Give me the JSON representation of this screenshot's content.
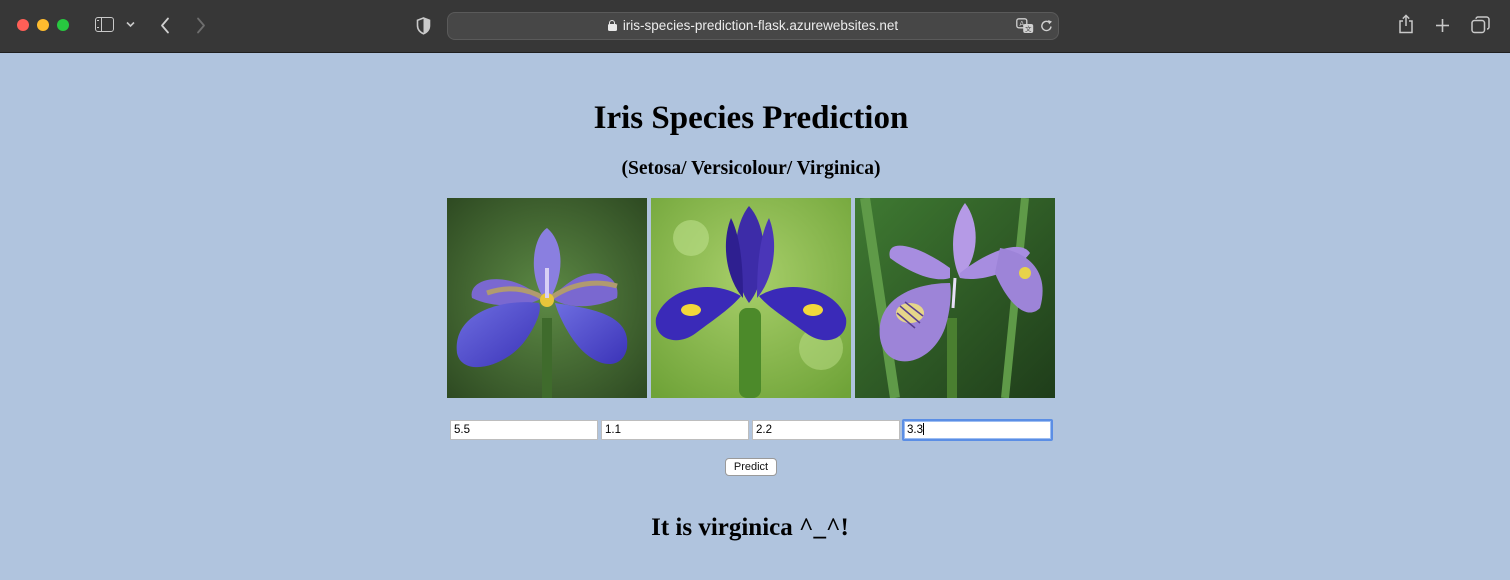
{
  "browser": {
    "url": "iris-species-prediction-flask.azurewebsites.net"
  },
  "page": {
    "title": "Iris Species Prediction",
    "subtitle": "(Setosa/ Versicolour/ Virginica)",
    "inputs": [
      {
        "value": "5.5"
      },
      {
        "value": "1.1"
      },
      {
        "value": "2.2"
      },
      {
        "value": "3.3"
      }
    ],
    "predict_label": "Predict",
    "result": "It is virginica ^_^!"
  },
  "colors": {
    "page_background": "#b0c4de",
    "toolbar": "#373737",
    "focus_ring": "#5b8ee5"
  },
  "icons": [
    "close-window-icon",
    "minimize-window-icon",
    "zoom-window-icon",
    "sidebar-icon",
    "chevron-down-icon",
    "back-arrow-icon",
    "forward-arrow-icon",
    "shield-icon",
    "lock-icon",
    "translate-icon",
    "reload-icon",
    "share-icon",
    "new-tab-icon",
    "tab-overview-icon"
  ]
}
